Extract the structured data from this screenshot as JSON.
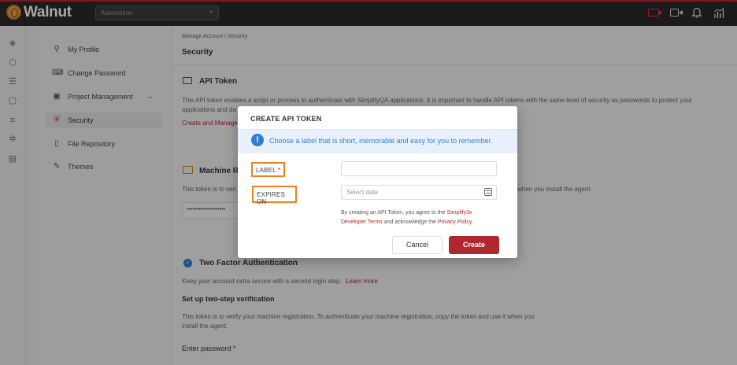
{
  "app": {
    "name": "Walnut",
    "workspace": "Automation"
  },
  "sidebar": {
    "items": [
      {
        "label": "My Profile"
      },
      {
        "label": "Change Password"
      },
      {
        "label": "Project Management"
      },
      {
        "label": "Security"
      },
      {
        "label": "File Repository"
      },
      {
        "label": "Themes"
      }
    ]
  },
  "breadcrumb": "Manage Account / Security",
  "page_title": "Security",
  "api_token": {
    "heading": "API Token",
    "description_line1": "This API token enables a script or process to authenticate with SimplifyQA applications. It is important to handle API tokens with the same level of security as passwords to protect your",
    "description_line2": "applications and da",
    "create_link": "Create and Manage"
  },
  "machine": {
    "heading": "Machine Re",
    "description_start": "This token is to veri",
    "description_end": "when you install the agent.",
    "masked_token": "••••••••••••••••••••"
  },
  "two_factor": {
    "heading": "Two Factor Authentication",
    "description": "Keep your account extra secure with a second login step.",
    "learn_more": "Learn more",
    "setup_heading": "Set up two-step verification",
    "setup_line1": "This token is to verify your machine registration. To authenticate your machine registration, copy the token and use it when you",
    "setup_line2": "install the agent.",
    "password_label": "Enter password *"
  },
  "modal": {
    "title": "CREATE API TOKEN",
    "info": "Choose a label that is short, memorable and easy for you to remember.",
    "label_field": "LABEL *",
    "expires_field": "EXPIRES ON",
    "expires_placeholder": "Select date",
    "terms_prefix": "By creating an API Token, you agree to the",
    "terms_link": "Simplify3x Developer Terms",
    "terms_middle": "and acknowledge the",
    "privacy_link": "Privacy Policy.",
    "cancel_label": "Cancel",
    "create_label": "Create"
  },
  "colors": {
    "accent": "#b0272d",
    "info": "#2d7fd3",
    "highlight": "#f07f1f"
  }
}
